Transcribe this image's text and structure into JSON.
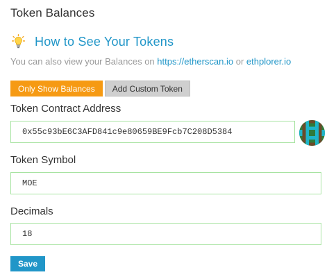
{
  "section_title": "Token Balances",
  "howto": {
    "icon": "lightbulb-icon",
    "link_text": "How to See Your Tokens"
  },
  "subline": {
    "prefix": "You can also view your Balances on ",
    "link1": "https://etherscan.io",
    "middle": " or ",
    "link2": "ethplorer.io"
  },
  "buttons": {
    "only_show_balances": "Only Show Balances",
    "add_custom_token": "Add Custom Token"
  },
  "form": {
    "contract_address": {
      "label": "Token Contract Address",
      "value": "0x55c93bE6C3AFD841c9e80659BE9Fcb7C208D5384"
    },
    "symbol": {
      "label": "Token Symbol",
      "value": "MOE"
    },
    "decimals": {
      "label": "Decimals",
      "value": "18"
    },
    "save_label": "Save"
  },
  "identicon": {
    "icon": "identicon-avatar"
  },
  "colors": {
    "accent_blue": "#2196c8",
    "orange": "#f69a13",
    "input_border": "#a7e3a1",
    "muted_text": "#9a9a9a"
  }
}
